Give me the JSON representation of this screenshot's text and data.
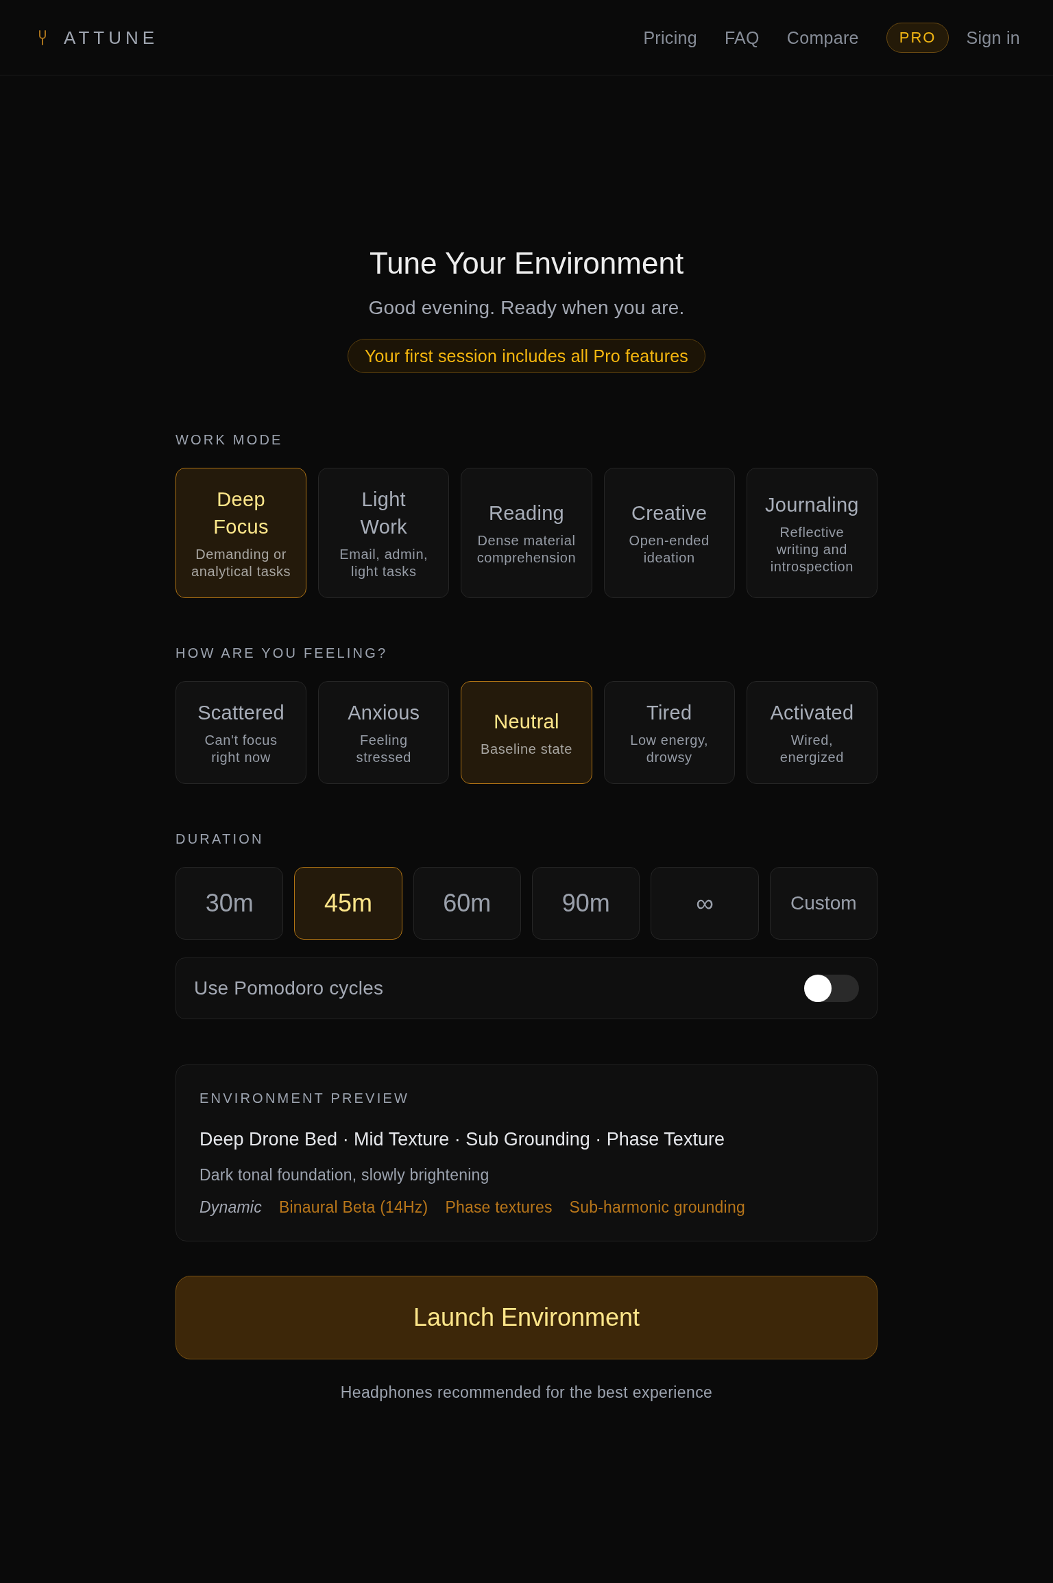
{
  "header": {
    "brand": "ATTUNE",
    "nav": [
      "Pricing",
      "FAQ",
      "Compare"
    ],
    "pro_badge": "PRO",
    "sign_in": "Sign in"
  },
  "hero": {
    "title": "Tune Your Environment",
    "subtitle": "Good evening. Ready when you are.",
    "promo": "Your first session includes all Pro features"
  },
  "work_mode": {
    "label": "WORK MODE",
    "options": [
      {
        "title": "Deep Focus",
        "description": "Demanding or analytical tasks",
        "selected": true
      },
      {
        "title": "Light Work",
        "description": "Email, admin, light tasks",
        "selected": false
      },
      {
        "title": "Reading",
        "description": "Dense material comprehension",
        "selected": false
      },
      {
        "title": "Creative",
        "description": "Open-ended ideation",
        "selected": false
      },
      {
        "title": "Journaling",
        "description": "Reflective writing and introspection",
        "selected": false
      }
    ]
  },
  "feeling": {
    "label": "HOW ARE YOU FEELING?",
    "options": [
      {
        "title": "Scattered",
        "description": "Can't focus right now",
        "selected": false
      },
      {
        "title": "Anxious",
        "description": "Feeling stressed",
        "selected": false
      },
      {
        "title": "Neutral",
        "description": "Baseline state",
        "selected": true
      },
      {
        "title": "Tired",
        "description": "Low energy, drowsy",
        "selected": false
      },
      {
        "title": "Activated",
        "description": "Wired, energized",
        "selected": false
      }
    ]
  },
  "duration": {
    "label": "DURATION",
    "options": [
      {
        "label": "30m",
        "kind": "preset",
        "selected": false
      },
      {
        "label": "45m",
        "kind": "preset",
        "selected": true
      },
      {
        "label": "60m",
        "kind": "preset",
        "selected": false
      },
      {
        "label": "90m",
        "kind": "preset",
        "selected": false
      },
      {
        "label": "∞",
        "kind": "preset",
        "selected": false
      },
      {
        "label": "Custom",
        "kind": "custom",
        "selected": false
      }
    ]
  },
  "pomodoro": {
    "label": "Use Pomodoro cycles",
    "on": false
  },
  "preview": {
    "label": "ENVIRONMENT PREVIEW",
    "layers": "Deep Drone Bed · Mid Texture · Sub Grounding · Phase Texture",
    "description": "Dark tonal foundation, slowly brightening",
    "tags": [
      {
        "label": "Dynamic",
        "kind": "mode"
      },
      {
        "label": "Binaural Beta (14Hz)",
        "kind": "feature"
      },
      {
        "label": "Phase textures",
        "kind": "feature"
      },
      {
        "label": "Sub-harmonic grounding",
        "kind": "feature"
      }
    ]
  },
  "launch": {
    "label": "Launch Environment"
  },
  "footer_note": "Headphones recommended for the best experience"
}
